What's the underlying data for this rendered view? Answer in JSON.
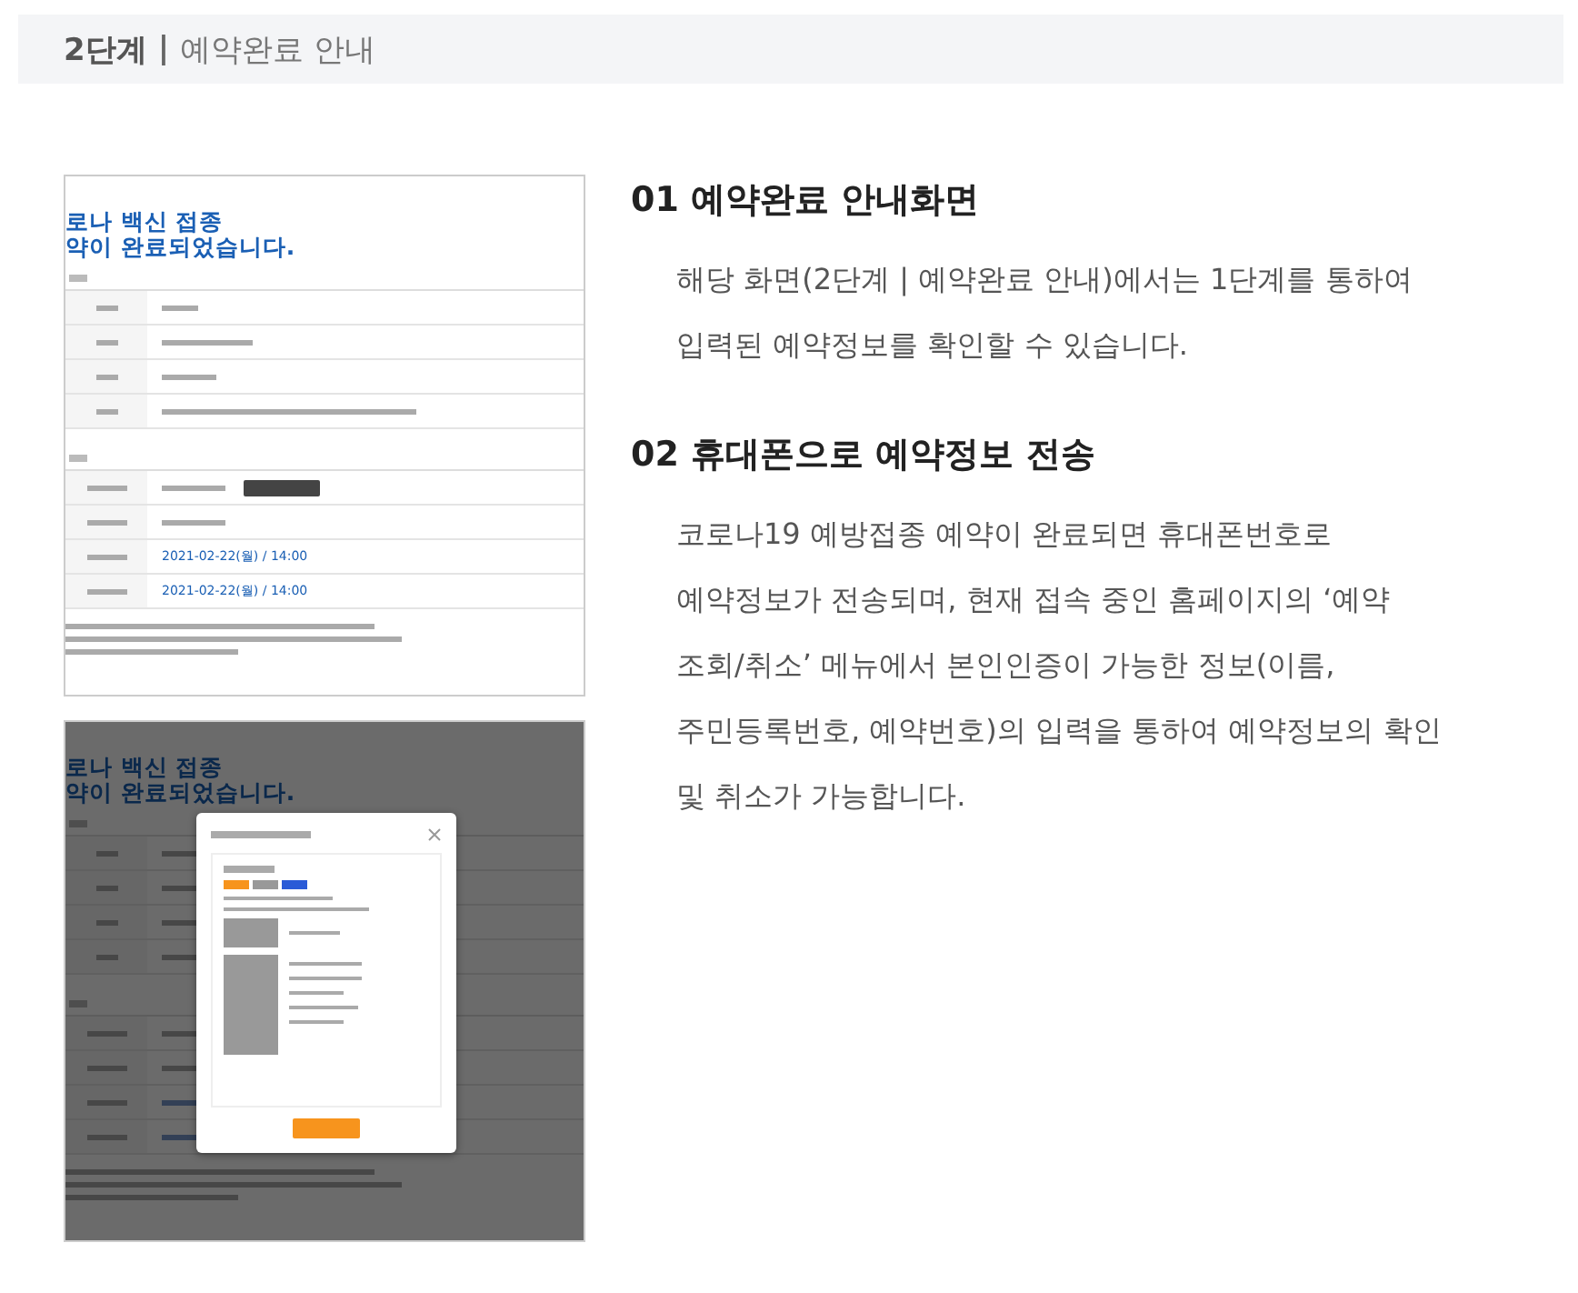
{
  "step_header": {
    "step": "2단계",
    "separator": "|",
    "title": "예약완료 안내"
  },
  "thumbnails": [
    {
      "heading": [
        "로나 백신 접종",
        "약이 완료되었습니다."
      ],
      "dates": [
        "2021-02-22(월) / 14:00",
        "2021-02-22(월) / 14:00"
      ],
      "dimmed": false
    },
    {
      "heading": [
        "로나 백신 접종",
        "약이 완료되었습니다."
      ],
      "dimmed": true
    }
  ],
  "sections": [
    {
      "title": "01 예약완료 안내화면",
      "text": "해당 화면(2단계 | 예약완료 안내)에서는 1단계를 통하여\n입력된 예약정보를 확인할 수 있습니다."
    },
    {
      "title": "02 휴대폰으로 예약정보 전송",
      "text": "코로나19 예방접종 예약이 완료되면 휴대폰번호로\n예약정보가 전송되며, 현재 접속 중인 홈페이지의 ‘예약\n조회/취소’ 메뉴에서 본인인증이 가능한 정보(이름,\n주민등록번호, 예약번호)의 입력을 통하여 예약정보의 확인\n및 취소가 가능합니다."
    }
  ]
}
